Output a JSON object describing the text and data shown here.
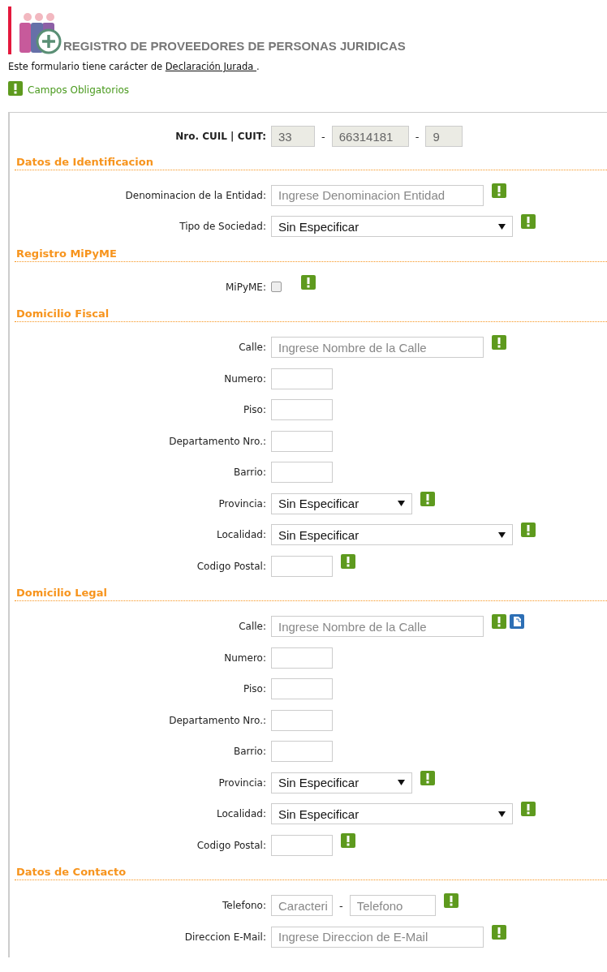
{
  "title": "REGISTRO DE PROVEEDORES DE PERSONAS JURIDICAS",
  "notice": {
    "text": "Este formulario tiene carácter de",
    "link": "Declaración Jurada ",
    "after": "."
  },
  "legend": "Campos Obligatorios",
  "cuit": {
    "label": "Nro. CUIL | CUIT:",
    "parts": [
      "33",
      "66314181",
      "9"
    ],
    "separator": "-"
  },
  "sections": [
    {
      "title": "Datos de Identificacion",
      "rows": [
        {
          "label": "Denominacion de la Entidad:",
          "kind": "text",
          "placeholder": "Ingrese Denominacion Entidad",
          "required": true
        },
        {
          "label": "Tipo de Sociedad:",
          "kind": "select",
          "value": "Sin Especificar",
          "required": true
        }
      ]
    },
    {
      "title": "Registro MiPyME",
      "rows": [
        {
          "label": "MiPyME:",
          "kind": "checkbox",
          "checked": false,
          "required": true
        }
      ]
    },
    {
      "title": "Domicilio Fiscal",
      "rows": [
        {
          "label": "Calle:",
          "kind": "text",
          "placeholder": "Ingrese Nombre de la Calle",
          "required": true
        },
        {
          "label": "Numero:",
          "kind": "short",
          "required": false
        },
        {
          "label": "Piso:",
          "kind": "short",
          "required": false
        },
        {
          "label": "Departamento Nro.:",
          "kind": "short",
          "required": false
        },
        {
          "label": "Barrio:",
          "kind": "short",
          "required": false
        },
        {
          "label": "Provincia:",
          "kind": "combo",
          "value": "Sin Especificar",
          "required": true
        },
        {
          "label": "Localidad:",
          "kind": "select",
          "value": "Sin Especificar",
          "required": true
        },
        {
          "label": "Codigo Postal:",
          "kind": "short",
          "required": true
        }
      ]
    },
    {
      "title": "Domicilio Legal",
      "rows": [
        {
          "label": "Calle:",
          "kind": "text",
          "placeholder": "Ingrese Nombre de la Calle",
          "required": true,
          "copy": true
        },
        {
          "label": "Numero:",
          "kind": "short",
          "required": false
        },
        {
          "label": "Piso:",
          "kind": "short",
          "required": false
        },
        {
          "label": "Departamento Nro.:",
          "kind": "short",
          "required": false
        },
        {
          "label": "Barrio:",
          "kind": "short",
          "required": false
        },
        {
          "label": "Provincia:",
          "kind": "combo",
          "value": "Sin Especificar",
          "required": true
        },
        {
          "label": "Localidad:",
          "kind": "select",
          "value": "Sin Especificar",
          "required": true
        },
        {
          "label": "Codigo Postal:",
          "kind": "short",
          "required": true
        }
      ]
    },
    {
      "title": "Datos de Contacto",
      "rows": [
        {
          "label": "Telefono:",
          "kind": "phone",
          "placeholders": [
            "Caracteri",
            "Telefono"
          ],
          "separator": "-",
          "required": true
        },
        {
          "label": "Direccion E-Mail:",
          "kind": "text",
          "placeholder": "Ingrese Direccion de E-Mail",
          "required": true
        }
      ]
    }
  ]
}
